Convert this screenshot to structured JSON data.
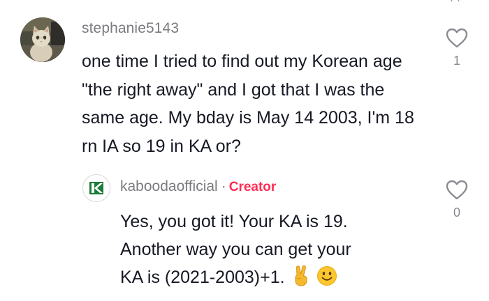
{
  "comment": {
    "username": "stephanie5143",
    "text": "one time I tried to find out my Korean age \"the right away\" and I got that I was the same age. My bday is May 14 2003, I'm 18 rn IA so 19 in KA or?",
    "like_count": "1",
    "avatar_icon": "cat-photo-avatar"
  },
  "reply": {
    "username": "kaboodaofficial",
    "separator": "·",
    "badge": "Creator",
    "text_line1": "Yes, you got it! Your KA is 19.",
    "text_line2": "Another way you can get your",
    "text_line3": "KA is (2021-2003)+1.",
    "emojis": [
      "victory-hand-emoji",
      "smiling-face-emoji"
    ],
    "like_count": "0",
    "avatar_icon": "kabooda-logo"
  },
  "colors": {
    "creator_accent": "#fe2c55",
    "muted_text": "#7a7b7f",
    "body_text": "#161823",
    "logo_green": "#1b7d3a"
  }
}
